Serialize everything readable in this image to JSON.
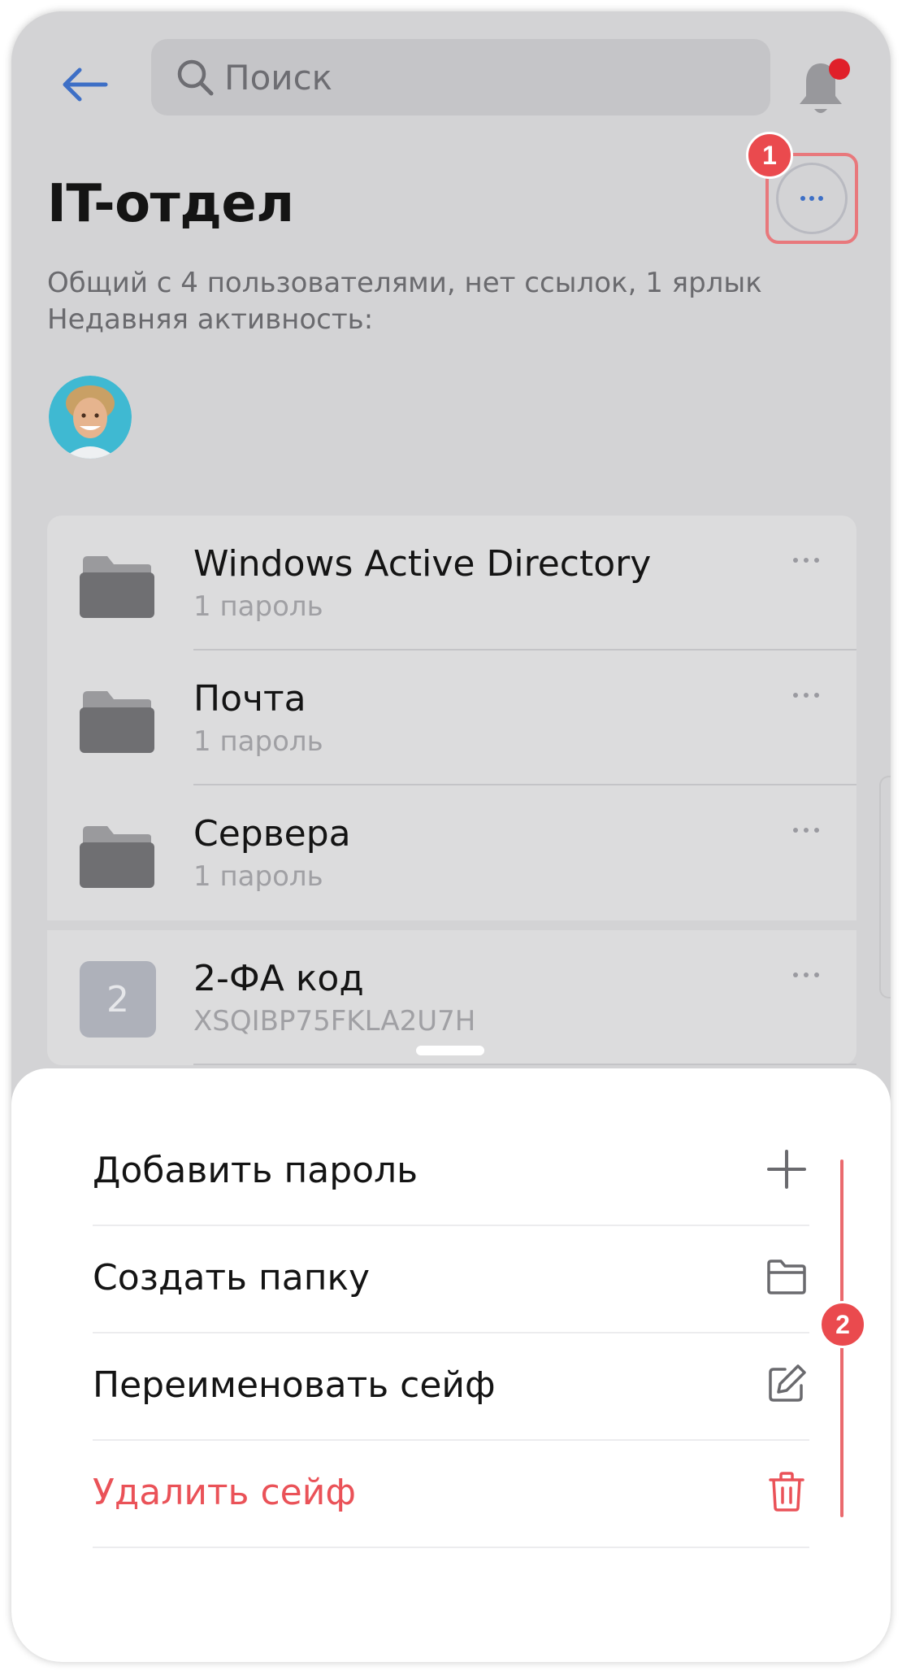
{
  "header": {
    "search_placeholder": "Поиск"
  },
  "vault": {
    "title": "IT-отдел",
    "info_line1": "Общий с 4 пользователями, нет ссылок, 1 ярлык",
    "info_line2": "Недавняя активность:"
  },
  "annotations": {
    "badge1": "1",
    "badge2": "2"
  },
  "items": [
    {
      "name": "Windows Active Directory",
      "sub": "1 пароль",
      "icon": "folder-icon"
    },
    {
      "name": "Почта",
      "sub": "1 пароль",
      "icon": "folder-icon"
    },
    {
      "name": "Сервера",
      "sub": "1 пароль",
      "icon": "folder-icon"
    }
  ],
  "twofa": {
    "tile": "2",
    "name": "2-ФА код",
    "sub": "XSQIBP75FKLA2U7H"
  },
  "menu": {
    "add_password": "Добавить пароль",
    "create_folder": "Создать папку",
    "rename_vault": "Переименовать сейф",
    "delete_vault": "Удалить сейф"
  },
  "colors": {
    "accent_blue": "#3d6fc6",
    "danger_red": "#ea5258",
    "annotation_red": "#ea4a4e",
    "notification_dot": "#e0202a"
  }
}
